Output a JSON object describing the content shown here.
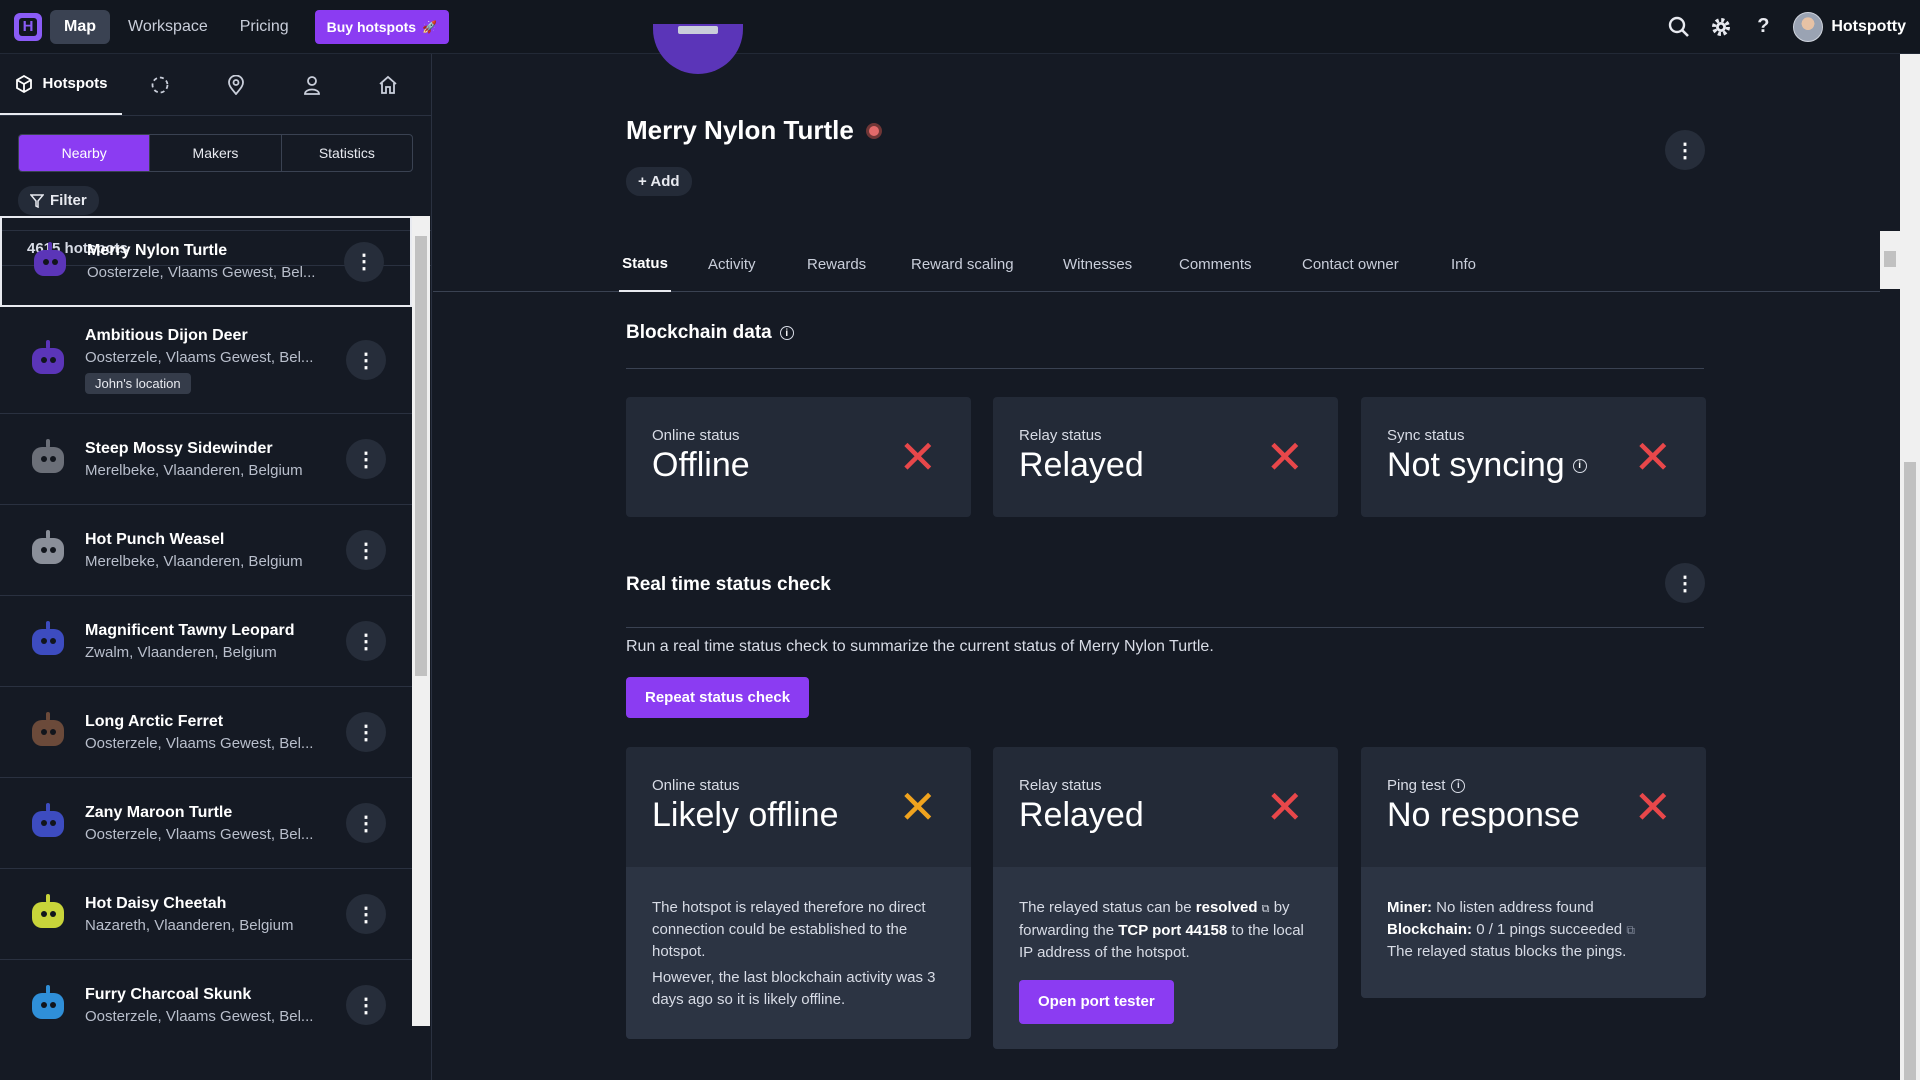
{
  "nav": {
    "logo_letter": "H",
    "links": [
      "Map",
      "Workspace",
      "Pricing"
    ],
    "buy_label": "Buy hotspots",
    "user_name": "Hotspotty"
  },
  "sidebar": {
    "active_tab": "Hotspots",
    "segments": [
      "Nearby",
      "Makers",
      "Statistics"
    ],
    "filter_label": "Filter",
    "count_label": "4615 hotspots",
    "items": [
      {
        "name": "Merry Nylon Turtle",
        "location": "Oosterzele, Vlaams Gewest, Bel...",
        "color": "#5b35b8"
      },
      {
        "name": "Ambitious Dijon Deer",
        "location": "Oosterzele, Vlaams Gewest, Bel...",
        "tag": "John's location",
        "color": "#5b35b8"
      },
      {
        "name": "Steep Mossy Sidewinder",
        "location": "Merelbeke, Vlaanderen, Belgium",
        "color": "#6b6f78"
      },
      {
        "name": "Hot Punch Weasel",
        "location": "Merelbeke, Vlaanderen, Belgium",
        "color": "#8a8f99"
      },
      {
        "name": "Magnificent Tawny Leopard",
        "location": "Zwalm, Vlaanderen, Belgium",
        "color": "#3d4cc0"
      },
      {
        "name": "Long Arctic Ferret",
        "location": "Oosterzele, Vlaams Gewest, Bel...",
        "color": "#6b4a3a"
      },
      {
        "name": "Zany Maroon Turtle",
        "location": "Oosterzele, Vlaams Gewest, Bel...",
        "color": "#3d4cc0"
      },
      {
        "name": "Hot Daisy Cheetah",
        "location": "Nazareth, Vlaanderen, Belgium",
        "color": "#c8d43a"
      },
      {
        "name": "Furry Charcoal Skunk",
        "location": "Oosterzele, Vlaams Gewest, Bel...",
        "color": "#2f8fd8"
      }
    ]
  },
  "hotspot": {
    "name": "Merry Nylon Turtle",
    "add_label": "Add"
  },
  "tabs": [
    "Status",
    "Activity",
    "Rewards",
    "Reward scaling",
    "Witnesses",
    "Comments",
    "Contact owner",
    "Info"
  ],
  "blockchain": {
    "title": "Blockchain data",
    "cards": [
      {
        "label": "Online status",
        "value": "Offline"
      },
      {
        "label": "Relay status",
        "value": "Relayed"
      },
      {
        "label": "Sync status",
        "value": "Not syncing"
      }
    ]
  },
  "realtime": {
    "title": "Real time status check",
    "description": "Run a real time status check to summarize the current status of Merry Nylon Turtle.",
    "repeat_label": "Repeat status check",
    "cards": [
      {
        "label": "Online status",
        "value": "Likely offline",
        "body1": "The hotspot is relayed therefore no direct connection could be established to the hotspot.",
        "body2": "However, the last blockchain activity was 3 days ago so it is likely offline."
      },
      {
        "label": "Relay status",
        "value": "Relayed",
        "text_a": "The relayed status can be",
        "link": "resolved",
        "text_b": "by forwarding the",
        "port": "TCP port 44158",
        "text_c": "to the local IP address of the hotspot.",
        "button": "Open port tester"
      },
      {
        "label": "Ping test",
        "value": "No response",
        "miner_label": "Miner:",
        "miner_value": "No listen address found",
        "chain_label": "Blockchain:",
        "chain_value": "0 / 1 pings succeeded",
        "note": "The relayed status blocks the pings."
      }
    ]
  },
  "colors": {
    "accent": "#8b3cf2",
    "error": "#e8474a",
    "warning": "#f0a31e"
  }
}
